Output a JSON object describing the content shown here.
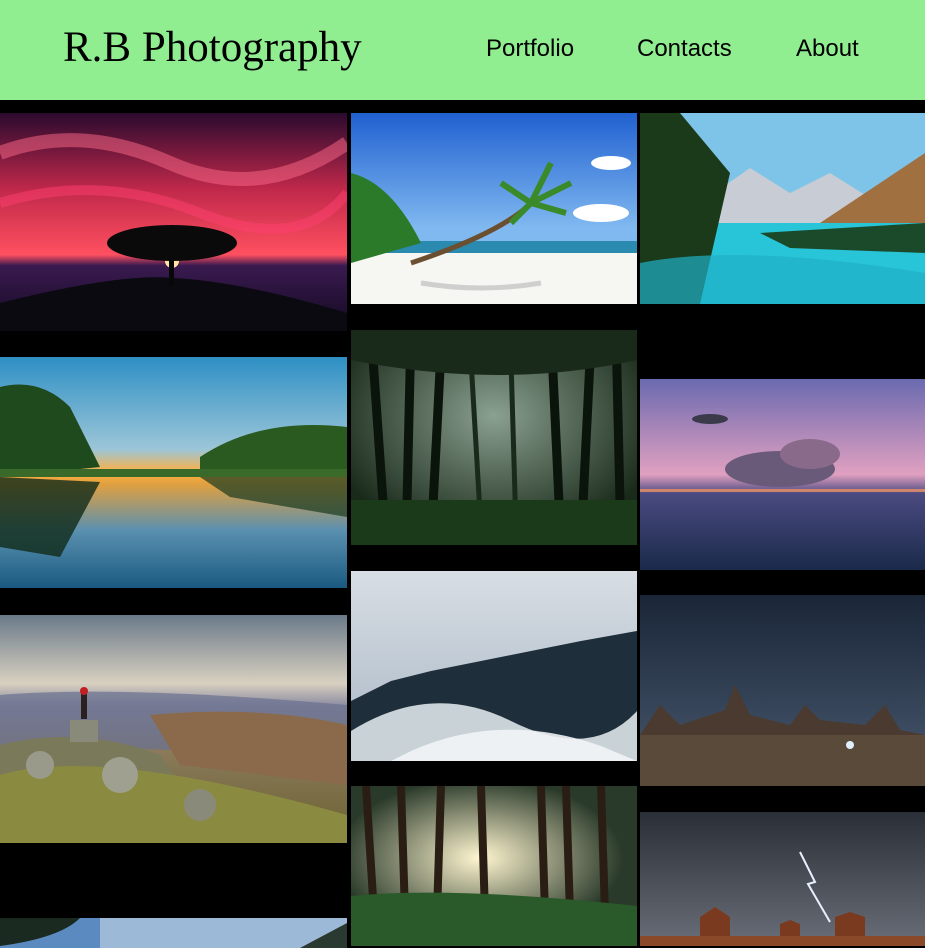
{
  "brand": {
    "title": "R.B Photography"
  },
  "nav": {
    "links": [
      {
        "label": "Portfolio"
      },
      {
        "label": "Contacts"
      },
      {
        "label": "About"
      }
    ]
  },
  "colors": {
    "header_bg": "#90ee90",
    "page_bg": "#000000"
  },
  "gallery": {
    "photos": [
      {
        "name": "tree-sunset-photo",
        "subject": "lone tree at red sunset"
      },
      {
        "name": "palm-beach-photo",
        "subject": "palm tree on tropical beach"
      },
      {
        "name": "mountain-lake-photo",
        "subject": "turquoise mountain lake"
      },
      {
        "name": "lake-reflection-photo",
        "subject": "sunset lake reflection"
      },
      {
        "name": "misty-forest-photo",
        "subject": "dark misty forest"
      },
      {
        "name": "ocean-clouds-photo",
        "subject": "pink clouds over ocean"
      },
      {
        "name": "hiker-hills-photo",
        "subject": "hiker on rocky hilltop"
      },
      {
        "name": "foggy-pines-photo",
        "subject": "fog over pine forest"
      },
      {
        "name": "desert-night-photo",
        "subject": "desert rock spires at night"
      },
      {
        "name": "redwood-sunlight-photo",
        "subject": "sunlit redwood forest"
      },
      {
        "name": "monument-lightning-photo",
        "subject": "lightning over monument valley"
      },
      {
        "name": "tree-sky-photo",
        "subject": "tree against blue sky"
      }
    ]
  }
}
